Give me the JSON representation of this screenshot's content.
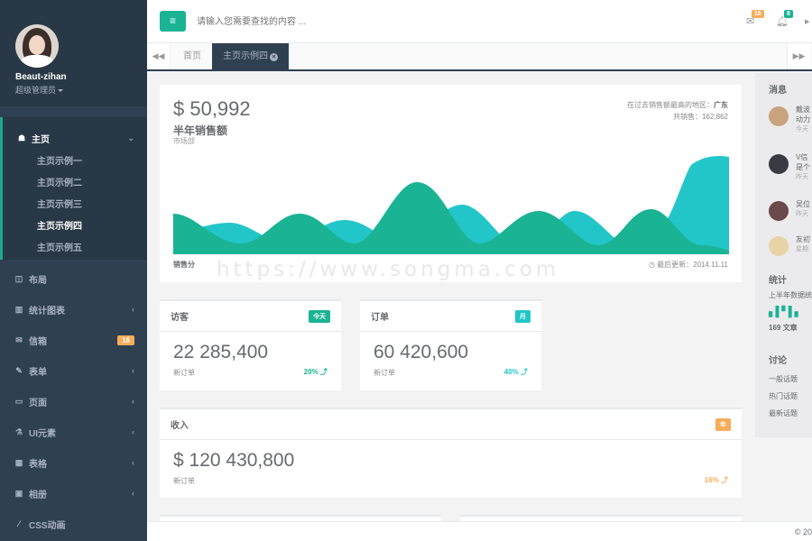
{
  "user": {
    "name": "Beaut-zihan",
    "role": "超级管理员"
  },
  "nav": {
    "home": {
      "label": "主页",
      "icon": "home-icon"
    },
    "home_sub": [
      "主页示例一",
      "主页示例二",
      "主页示例三",
      "主页示例四",
      "主页示例五"
    ],
    "items": [
      {
        "label": "布局",
        "icon": "columns-icon",
        "arrow": false
      },
      {
        "label": "统计图表",
        "icon": "bar-chart-icon",
        "arrow": true
      },
      {
        "label": "信箱",
        "icon": "envelope-icon",
        "badge": "16"
      },
      {
        "label": "表单",
        "icon": "edit-icon",
        "arrow": true
      },
      {
        "label": "页面",
        "icon": "desktop-icon",
        "arrow": true
      },
      {
        "label": "UI元素",
        "icon": "flask-icon",
        "arrow": true
      },
      {
        "label": "表格",
        "icon": "table-icon",
        "arrow": true
      },
      {
        "label": "相册",
        "icon": "picture-icon",
        "arrow": true
      },
      {
        "label": "CSS动画",
        "icon": "magic-icon",
        "arrow": false
      }
    ]
  },
  "topbar": {
    "search_placeholder": "请输入您需要查找的内容 ...",
    "mail_badge": "16",
    "bell_badge": "8"
  },
  "tabs": {
    "home": "首页",
    "active": "主页示例四"
  },
  "sales": {
    "amount": "$ 50,992",
    "title": "半年销售额",
    "dept": "市场部",
    "region_label": "在过去销售额最高的地区：",
    "region": "广东",
    "total_label": "共销售：",
    "total": "162,862",
    "foot_left": "销售分",
    "foot_right": "◷ 最后更新：2014.11.11"
  },
  "visitors": {
    "title": "访客",
    "label": "今天",
    "value": "22 285,400",
    "sub": "新订单",
    "pct": "20% ⤴"
  },
  "orders": {
    "title": "订单",
    "label": "月",
    "value": "60 420,600",
    "sub": "新订单",
    "pct": "40% ⤴"
  },
  "income": {
    "title": "收入",
    "label": "年",
    "value": "$ 120 430,800",
    "sub": "新订单",
    "pct": "16% ⤴"
  },
  "rightpanel": {
    "messages_title": "消息",
    "messages": [
      {
        "l1": "戴波",
        "l2": "动力",
        "l3": "今天"
      },
      {
        "l1": "V信",
        "l2": "是个",
        "l3": "昨天"
      },
      {
        "l1": "吴位",
        "l2": "",
        "l3": "昨天"
      },
      {
        "l1": "友初",
        "l2": "",
        "l3": "星期"
      }
    ],
    "stats_title": "统计",
    "stats_text": "上半年数据统",
    "articles": "169 文章",
    "discuss_title": "讨论",
    "discuss": [
      "一般话题",
      "热门话题",
      "最新话题"
    ]
  },
  "watermark": "https://www.songma.com",
  "footer": "© 20",
  "colors": {
    "primary": "#1ab394",
    "info": "#23c6c8",
    "warning": "#f8ac59",
    "sidebar": "#2f4050"
  }
}
